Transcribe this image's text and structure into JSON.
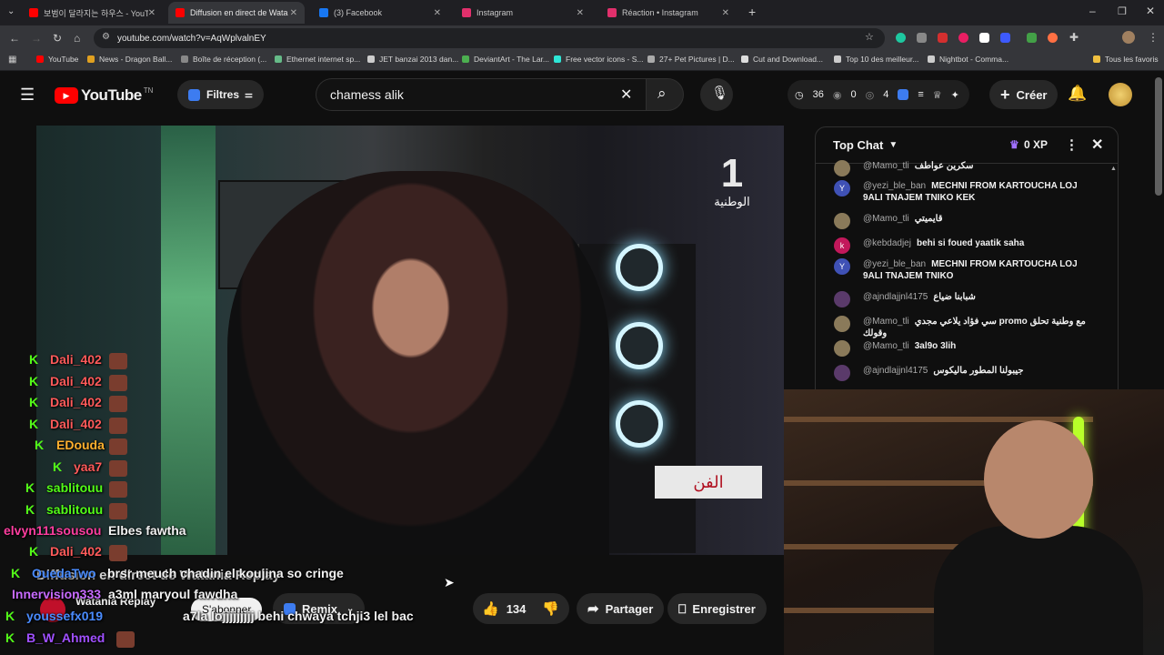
{
  "tabs": [
    {
      "title": "보범이 달라지는 하우스 - YouT",
      "color": "#ff0000"
    },
    {
      "title": "Diffusion en direct de Wata",
      "color": "#ff0000"
    },
    {
      "title": "(3) Facebook",
      "color": "#1877f2"
    },
    {
      "title": "Instagram",
      "color": "#e1306c"
    },
    {
      "title": "Réaction • Instagram",
      "color": "#e1306c"
    }
  ],
  "url": "youtube.com/watch?v=AqWplvalnEY",
  "bookmarks": [
    "YouTube",
    "News - Dragon Ball...",
    "Boîte de réception (...",
    "Ethernet internet sp...",
    "JET banzai 2013 dan...",
    "DeviantArt - The Lar...",
    "Free vector icons - S...",
    "27+ Pet Pictures | D...",
    "Cut and Download...",
    "Top 10 des meilleur...",
    "Nightbot - Comma...",
    "Tous les favoris"
  ],
  "header": {
    "logo": "YouTube",
    "logo_sup": "TN",
    "filters": "Filtres",
    "search_value": "chamess alik",
    "stats": [
      "36",
      "0",
      "4"
    ],
    "create": "Créer"
  },
  "video": {
    "channel_logo": "1",
    "channel_text": "الوطنية",
    "banner": "الفن"
  },
  "chat": {
    "title": "Top Chat",
    "xp": "0 XP",
    "messages": [
      {
        "author": "@Mamo_tli",
        "text": "سكرين عواطف",
        "avatar": "#8a7a5a",
        "initial": ""
      },
      {
        "author": "@yezi_ble_ban",
        "text": "MECHNI FROM KARTOUCHA LOJ 9ALI TNAJEM TNIKO KEK",
        "avatar": "#3f51b5",
        "initial": "Y"
      },
      {
        "author": "@Mamo_tli",
        "text": "قايميتي",
        "avatar": "#8a7a5a",
        "initial": ""
      },
      {
        "author": "@kebdadjej",
        "text": "behi si foued yaatik saha",
        "avatar": "#c2185b",
        "initial": "k"
      },
      {
        "author": "@yezi_ble_ban",
        "text": "MECHNI FROM KARTOUCHA LOJ 9ALI TNAJEM TNIKO",
        "avatar": "#3f51b5",
        "initial": "Y"
      },
      {
        "author": "@ajndlajjnl4175",
        "text": "شبابنا ضياع",
        "avatar": "#5a3a6a",
        "initial": ""
      },
      {
        "author": "@Mamo_tli",
        "text": "سي فؤاد يلاعي مجدي promo مع وطنية تحلق وقولك",
        "avatar": "#8a7a5a",
        "initial": ""
      },
      {
        "author": "@Mamo_tli",
        "text": "3al9o 3lih",
        "avatar": "#8a7a5a",
        "initial": ""
      },
      {
        "author": "@ajndlajjnl4175",
        "text": "جيبولنا المطور ماليكوس",
        "avatar": "#5a3a6a",
        "initial": ""
      }
    ]
  },
  "overlay_chat": [
    {
      "name": "Dali_402",
      "text": "",
      "kick": true
    },
    {
      "name": "Dali_402",
      "text": "",
      "kick": true
    },
    {
      "name": "Dali_402",
      "text": "",
      "kick": true
    },
    {
      "name": "Dali_402",
      "text": "",
      "kick": true
    },
    {
      "name": "EDouda",
      "text": "",
      "kick": true
    },
    {
      "name": "yaa7",
      "text": "",
      "kick": true
    },
    {
      "name": "sablitouu",
      "text": "",
      "kick": true
    },
    {
      "name": "sablitouu",
      "text": "",
      "kick": true
    },
    {
      "name": "elvyn111sousou",
      "text": "Elbes fawtha",
      "kick": false
    },
    {
      "name": "Dali_402",
      "text": "",
      "kick": true
    },
    {
      "name": "OuedaTwo",
      "text": "brsr meuch chadin el koujina so cringe",
      "kick": true
    },
    {
      "name": "Innervision333",
      "text": "a3ml maryoul fawdha",
      "kick": false
    },
    {
      "name": "youssefx019",
      "text": "a7la lojjjjjjjjj behi chwaya tchji3 lel bac",
      "kick": true
    },
    {
      "name": "B_W_Ahmed",
      "text": "",
      "kick": true
    }
  ],
  "below": {
    "title": "Diffusion en direct de Watania Replay",
    "channel": "Watania Replay",
    "subscribe": "S'abonner",
    "remix": "Remix",
    "likes": "134",
    "share": "Partager",
    "save": "Enregistrer"
  }
}
